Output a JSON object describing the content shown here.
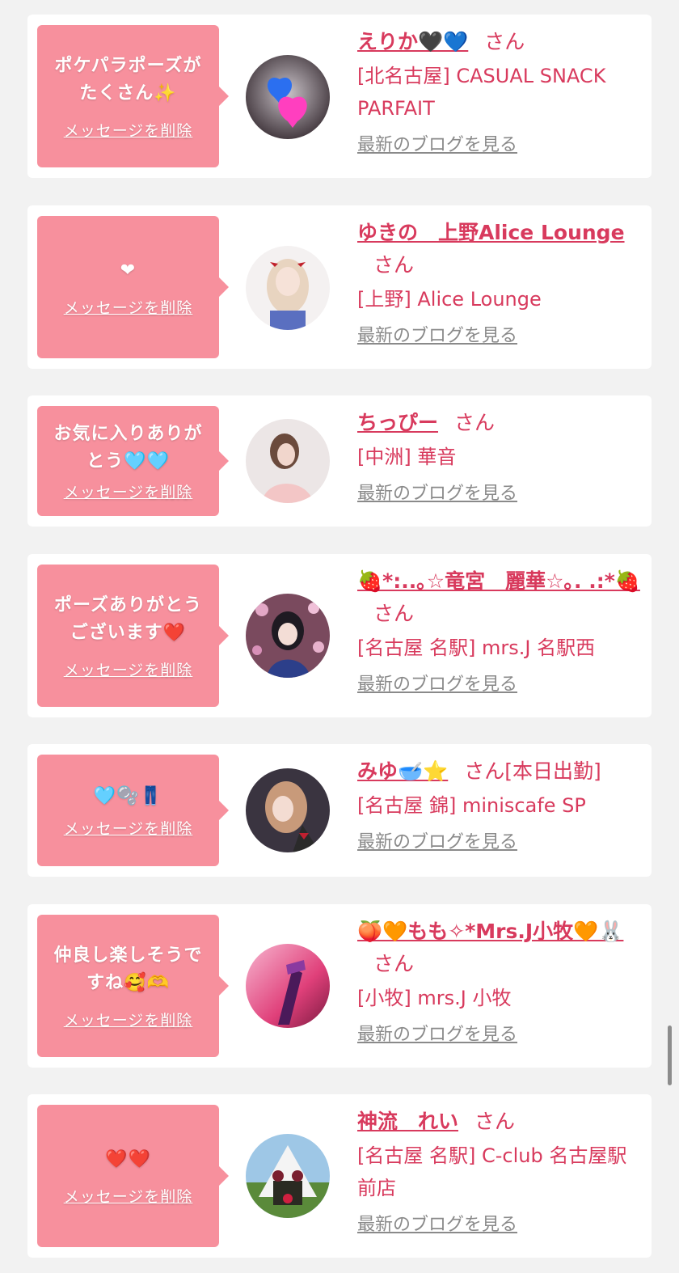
{
  "common": {
    "delete_label": "メッセージを削除",
    "blog_label": "最新のブログを見る",
    "honorific": "さん"
  },
  "colors": {
    "background": "#f2f2f2",
    "card": "#ffffff",
    "bubble": "#f7909d",
    "accent_text": "#d83a5d",
    "blog_link": "#8a8a8a"
  },
  "items": [
    {
      "message": "ポケパラポーズがたくさん✨",
      "name": "えりか🖤💙",
      "shop": "[北名古屋] CASUAL SNACK PARFAIT",
      "extra": "",
      "avatar_icon": "avatar-heart-photo"
    },
    {
      "message": "❤",
      "name": "ゆきの　上野Alice Lounge",
      "shop": "[上野] Alice Lounge",
      "extra": "",
      "avatar_icon": "avatar-blonde-girl"
    },
    {
      "message": "お気に入りありがとう🩵🩵",
      "name": "ちっぴー",
      "shop": "[中洲] 華音",
      "extra": "",
      "avatar_icon": "avatar-girl-pink"
    },
    {
      "message": "ポーズありがとうございます❤️",
      "name": "🍓*:..｡☆竜宮　麗華☆｡. .:*🍓",
      "shop": "[名古屋 名駅] mrs.J 名駅西",
      "extra": "",
      "avatar_icon": "avatar-kimono-girl"
    },
    {
      "message": "🩵🫧👖",
      "name": "みゆ🥣⭐",
      "shop": "[名古屋 錦] miniscafe SP",
      "extra": "[本日出勤]",
      "avatar_icon": "avatar-girl-selfie"
    },
    {
      "message": "仲良し楽しそうですね🥰🫶",
      "name": "🍑🧡もも✧*Mrs.J小牧🧡🐰",
      "shop": "[小牧] mrs.J 小牧",
      "extra": "",
      "avatar_icon": "avatar-pink-abstract"
    },
    {
      "message": "❤️❤️",
      "name": "神流　れい",
      "shop": "[名古屋 名駅] C-club 名古屋駅前店",
      "extra": "",
      "avatar_icon": "avatar-onigiri"
    }
  ]
}
